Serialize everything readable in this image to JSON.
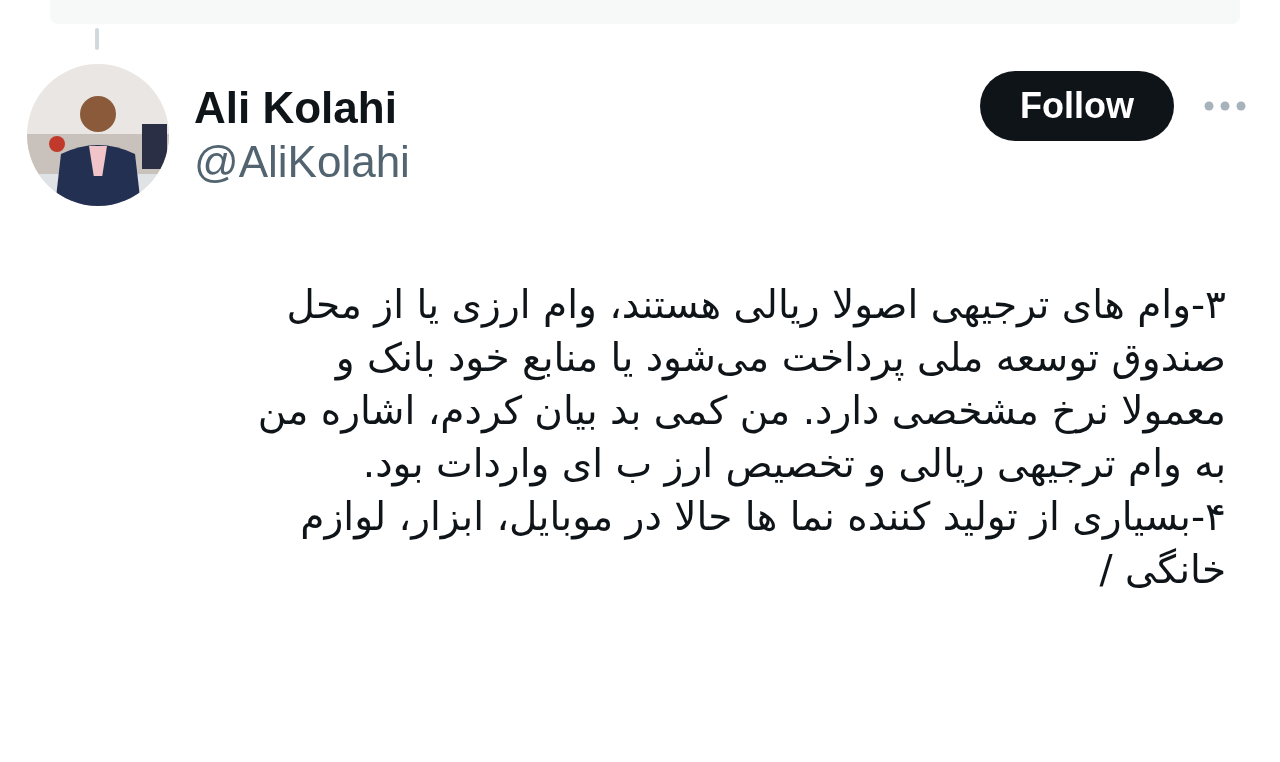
{
  "author": {
    "name": "Ali Kolahi",
    "handle": "@AliKolahi"
  },
  "follow_button": {
    "label": "Follow"
  },
  "tweet_lines": [
    "۳-وام های ترجیهی اصولا ریالی هستند، وام ارزی یا از محل",
    "صندوق توسعه ملی پرداخت می‌شود یا منابع خود بانک و",
    "معمولا نرخ مشخصی دارد. من کمی بد بیان کردم، اشاره من",
    "به وام ترجیهی ریالی و تخصیص ارز ب ای واردات بود.",
    "۴-بسیاری از تولید کننده نما ها حالا در موبایل، ابزار، لوازم",
    "خانگی /"
  ]
}
